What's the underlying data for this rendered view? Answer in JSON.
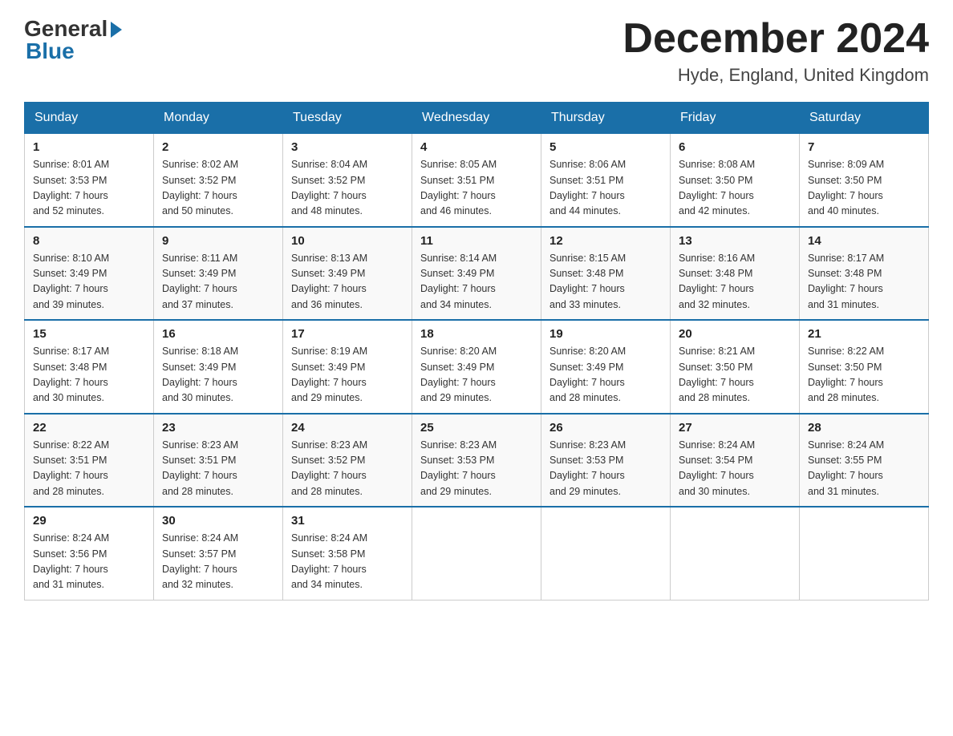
{
  "header": {
    "logo_general": "General",
    "logo_blue": "Blue",
    "month_title": "December 2024",
    "location": "Hyde, England, United Kingdom"
  },
  "days_of_week": [
    "Sunday",
    "Monday",
    "Tuesday",
    "Wednesday",
    "Thursday",
    "Friday",
    "Saturday"
  ],
  "weeks": [
    [
      {
        "day": 1,
        "info": "Sunrise: 8:01 AM\nSunset: 3:53 PM\nDaylight: 7 hours\nand 52 minutes."
      },
      {
        "day": 2,
        "info": "Sunrise: 8:02 AM\nSunset: 3:52 PM\nDaylight: 7 hours\nand 50 minutes."
      },
      {
        "day": 3,
        "info": "Sunrise: 8:04 AM\nSunset: 3:52 PM\nDaylight: 7 hours\nand 48 minutes."
      },
      {
        "day": 4,
        "info": "Sunrise: 8:05 AM\nSunset: 3:51 PM\nDaylight: 7 hours\nand 46 minutes."
      },
      {
        "day": 5,
        "info": "Sunrise: 8:06 AM\nSunset: 3:51 PM\nDaylight: 7 hours\nand 44 minutes."
      },
      {
        "day": 6,
        "info": "Sunrise: 8:08 AM\nSunset: 3:50 PM\nDaylight: 7 hours\nand 42 minutes."
      },
      {
        "day": 7,
        "info": "Sunrise: 8:09 AM\nSunset: 3:50 PM\nDaylight: 7 hours\nand 40 minutes."
      }
    ],
    [
      {
        "day": 8,
        "info": "Sunrise: 8:10 AM\nSunset: 3:49 PM\nDaylight: 7 hours\nand 39 minutes."
      },
      {
        "day": 9,
        "info": "Sunrise: 8:11 AM\nSunset: 3:49 PM\nDaylight: 7 hours\nand 37 minutes."
      },
      {
        "day": 10,
        "info": "Sunrise: 8:13 AM\nSunset: 3:49 PM\nDaylight: 7 hours\nand 36 minutes."
      },
      {
        "day": 11,
        "info": "Sunrise: 8:14 AM\nSunset: 3:49 PM\nDaylight: 7 hours\nand 34 minutes."
      },
      {
        "day": 12,
        "info": "Sunrise: 8:15 AM\nSunset: 3:48 PM\nDaylight: 7 hours\nand 33 minutes."
      },
      {
        "day": 13,
        "info": "Sunrise: 8:16 AM\nSunset: 3:48 PM\nDaylight: 7 hours\nand 32 minutes."
      },
      {
        "day": 14,
        "info": "Sunrise: 8:17 AM\nSunset: 3:48 PM\nDaylight: 7 hours\nand 31 minutes."
      }
    ],
    [
      {
        "day": 15,
        "info": "Sunrise: 8:17 AM\nSunset: 3:48 PM\nDaylight: 7 hours\nand 30 minutes."
      },
      {
        "day": 16,
        "info": "Sunrise: 8:18 AM\nSunset: 3:49 PM\nDaylight: 7 hours\nand 30 minutes."
      },
      {
        "day": 17,
        "info": "Sunrise: 8:19 AM\nSunset: 3:49 PM\nDaylight: 7 hours\nand 29 minutes."
      },
      {
        "day": 18,
        "info": "Sunrise: 8:20 AM\nSunset: 3:49 PM\nDaylight: 7 hours\nand 29 minutes."
      },
      {
        "day": 19,
        "info": "Sunrise: 8:20 AM\nSunset: 3:49 PM\nDaylight: 7 hours\nand 28 minutes."
      },
      {
        "day": 20,
        "info": "Sunrise: 8:21 AM\nSunset: 3:50 PM\nDaylight: 7 hours\nand 28 minutes."
      },
      {
        "day": 21,
        "info": "Sunrise: 8:22 AM\nSunset: 3:50 PM\nDaylight: 7 hours\nand 28 minutes."
      }
    ],
    [
      {
        "day": 22,
        "info": "Sunrise: 8:22 AM\nSunset: 3:51 PM\nDaylight: 7 hours\nand 28 minutes."
      },
      {
        "day": 23,
        "info": "Sunrise: 8:23 AM\nSunset: 3:51 PM\nDaylight: 7 hours\nand 28 minutes."
      },
      {
        "day": 24,
        "info": "Sunrise: 8:23 AM\nSunset: 3:52 PM\nDaylight: 7 hours\nand 28 minutes."
      },
      {
        "day": 25,
        "info": "Sunrise: 8:23 AM\nSunset: 3:53 PM\nDaylight: 7 hours\nand 29 minutes."
      },
      {
        "day": 26,
        "info": "Sunrise: 8:23 AM\nSunset: 3:53 PM\nDaylight: 7 hours\nand 29 minutes."
      },
      {
        "day": 27,
        "info": "Sunrise: 8:24 AM\nSunset: 3:54 PM\nDaylight: 7 hours\nand 30 minutes."
      },
      {
        "day": 28,
        "info": "Sunrise: 8:24 AM\nSunset: 3:55 PM\nDaylight: 7 hours\nand 31 minutes."
      }
    ],
    [
      {
        "day": 29,
        "info": "Sunrise: 8:24 AM\nSunset: 3:56 PM\nDaylight: 7 hours\nand 31 minutes."
      },
      {
        "day": 30,
        "info": "Sunrise: 8:24 AM\nSunset: 3:57 PM\nDaylight: 7 hours\nand 32 minutes."
      },
      {
        "day": 31,
        "info": "Sunrise: 8:24 AM\nSunset: 3:58 PM\nDaylight: 7 hours\nand 34 minutes."
      },
      null,
      null,
      null,
      null
    ]
  ]
}
